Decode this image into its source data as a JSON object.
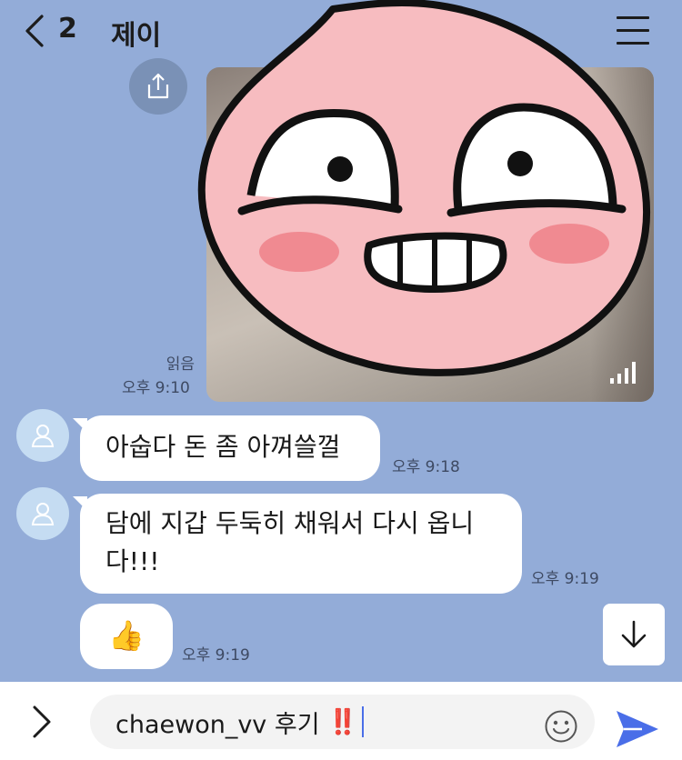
{
  "header": {
    "unread_count": "2",
    "title": "제이"
  },
  "messages": [
    {
      "read_label": "읽음",
      "time": "오후 9:10"
    },
    {
      "text": "아숩다 돈 좀 아껴쓸껄",
      "time": "오후 9:18"
    },
    {
      "text_line1": "담에 지갑 두둑히 채워서 다시 옵니",
      "text_line2": "다!!!",
      "time": "오후 9:19"
    },
    {
      "emoji": "👍",
      "time": "오후 9:19"
    }
  ],
  "input": {
    "value": "chaewon_vv 후기 ",
    "emphasis": "‼️"
  },
  "icons": [
    "back-icon",
    "menu-icon",
    "share-icon",
    "signal-icon",
    "avatar-icon",
    "scroll-down-icon",
    "expand-icon",
    "emoji-icon",
    "send-icon"
  ],
  "colors": {
    "chat_background": "#93acd8",
    "send_accent": "#4a6ee8",
    "sticker_pink": "#f5b9bd"
  }
}
